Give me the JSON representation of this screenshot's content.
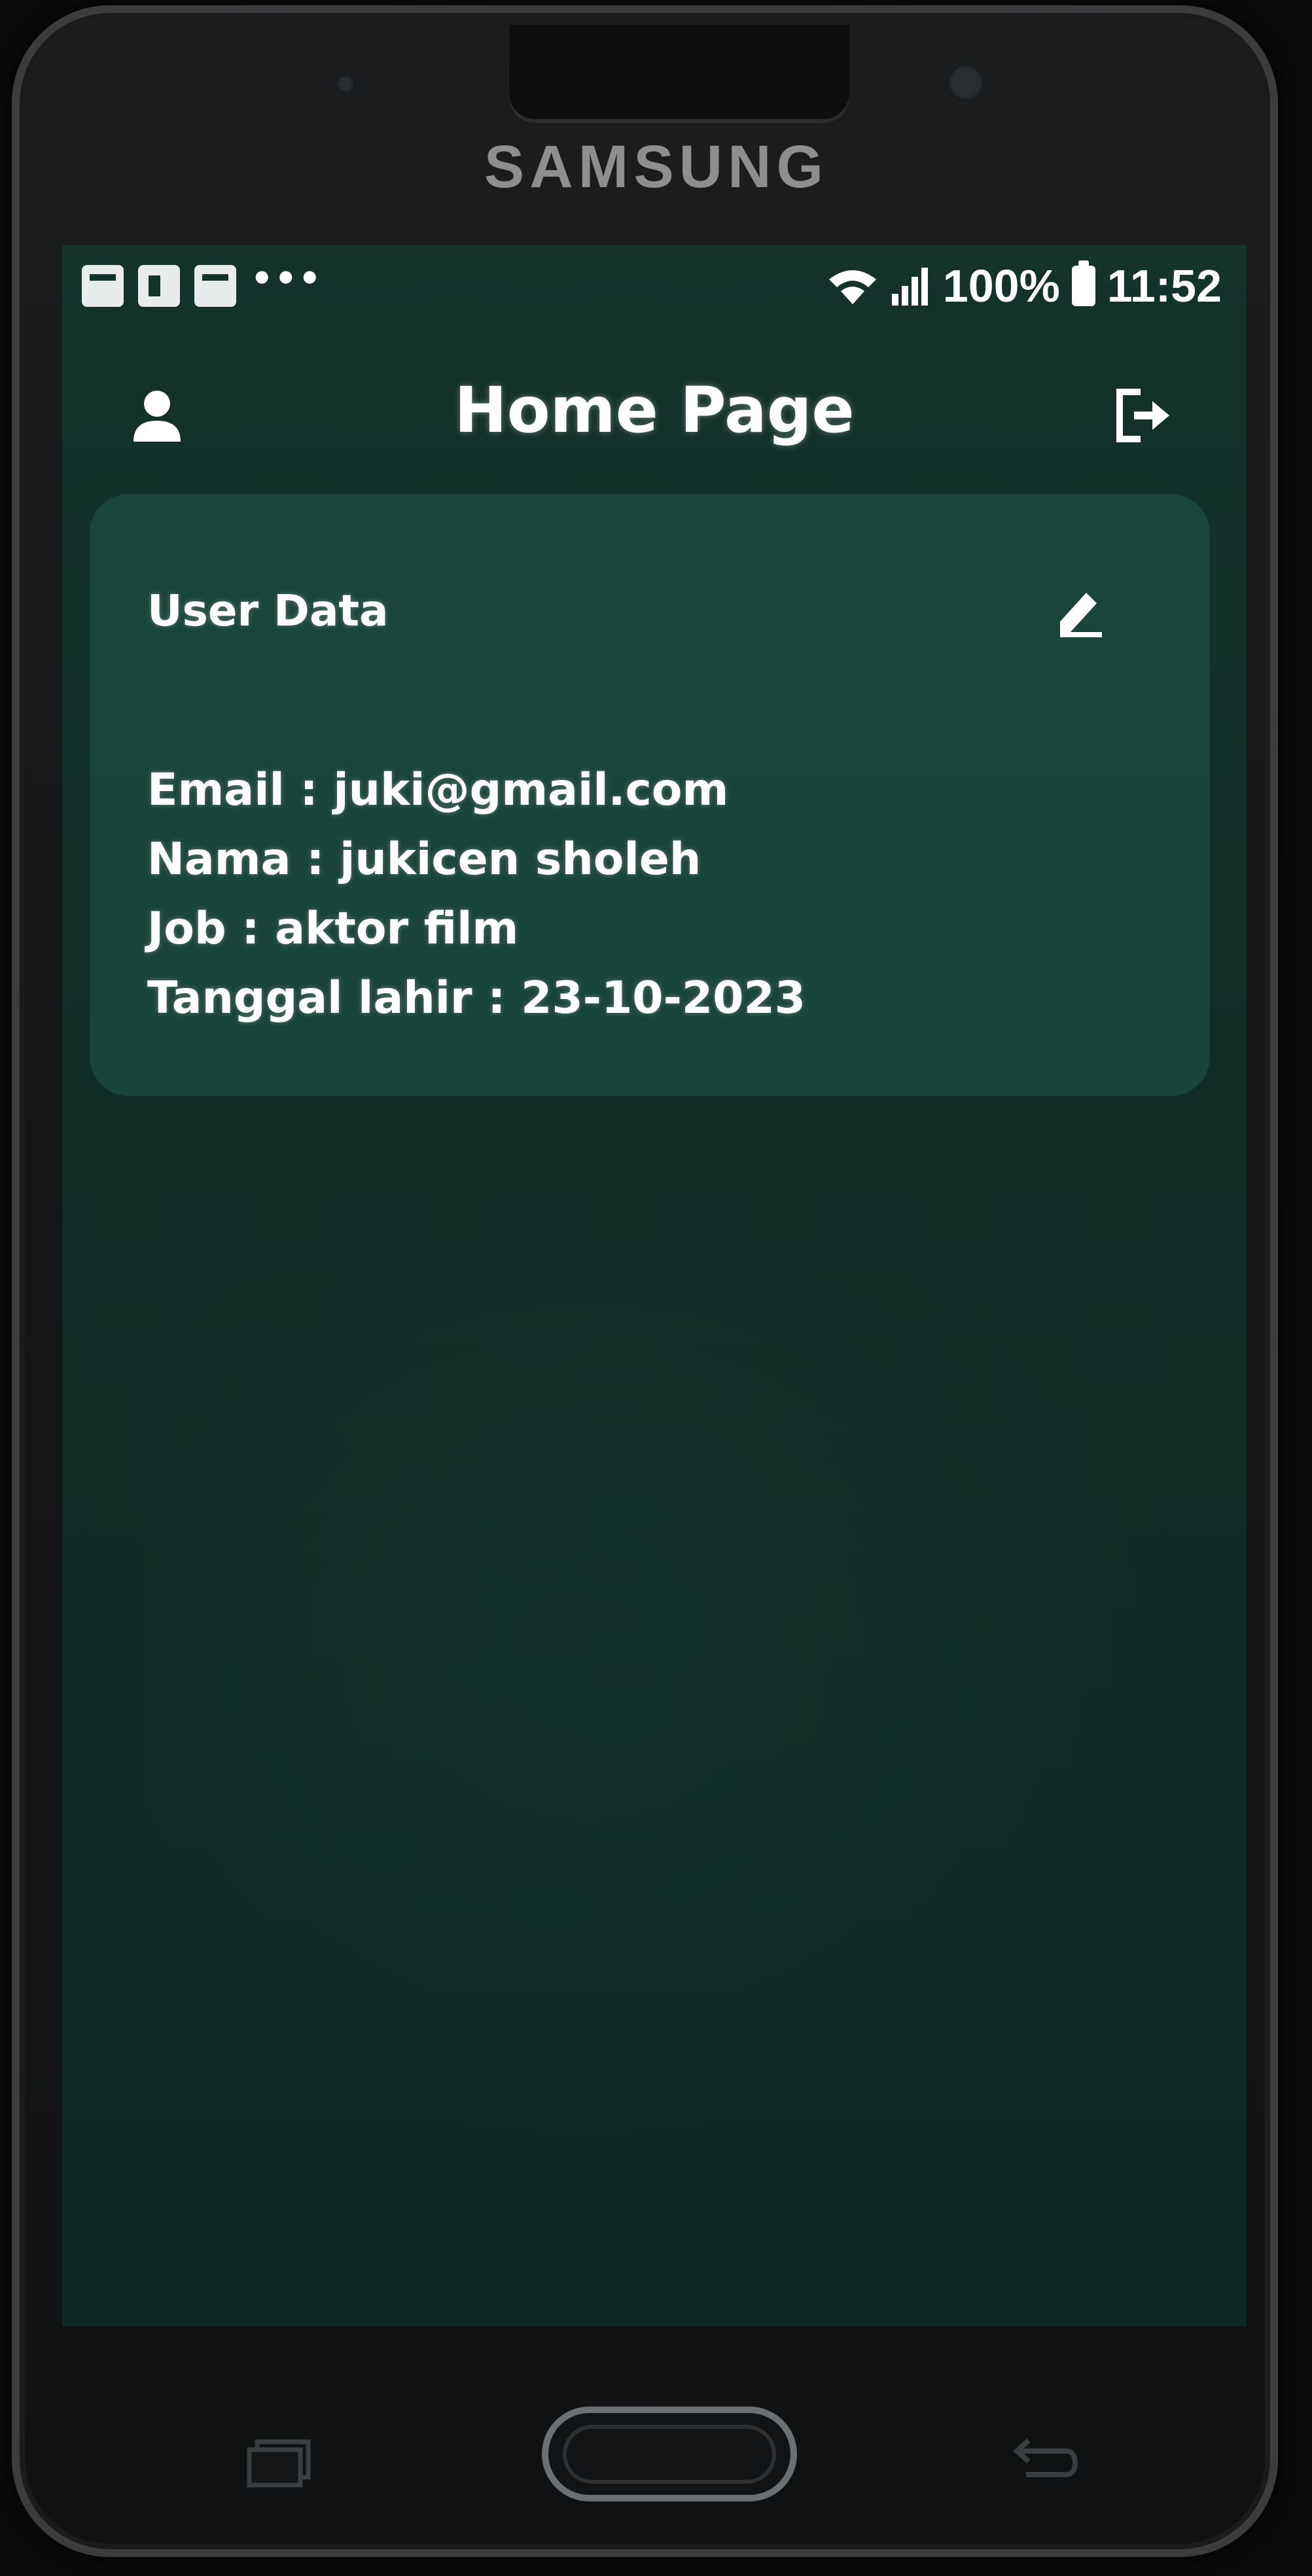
{
  "device": {
    "brand": "SAMSUNG"
  },
  "status_bar": {
    "battery": "100%",
    "time": "11:52",
    "more_indicator": "•••",
    "icons": [
      "notification-icon",
      "flipboard-icon",
      "notification-icon",
      "wifi-icon",
      "signal-icon",
      "battery-icon"
    ]
  },
  "header": {
    "title": "Home Page",
    "left_icon": "user-icon",
    "right_icon": "logout-icon"
  },
  "card": {
    "title": "User Data",
    "edit_icon": "edit-icon",
    "email_line": "Email : juki@gmail.com",
    "name_line": "Nama : jukicen sholeh",
    "job_line": "Job : aktor film",
    "birth_line": "Tanggal lahir : 23-10-2023"
  },
  "nav": {
    "recent_icon": "recent-apps-icon",
    "home_icon": "home-button",
    "back_icon": "back-icon"
  },
  "colors": {
    "screen_bg": "#0f2c25",
    "card_bg": "#1a463b",
    "text": "#ffffff"
  }
}
